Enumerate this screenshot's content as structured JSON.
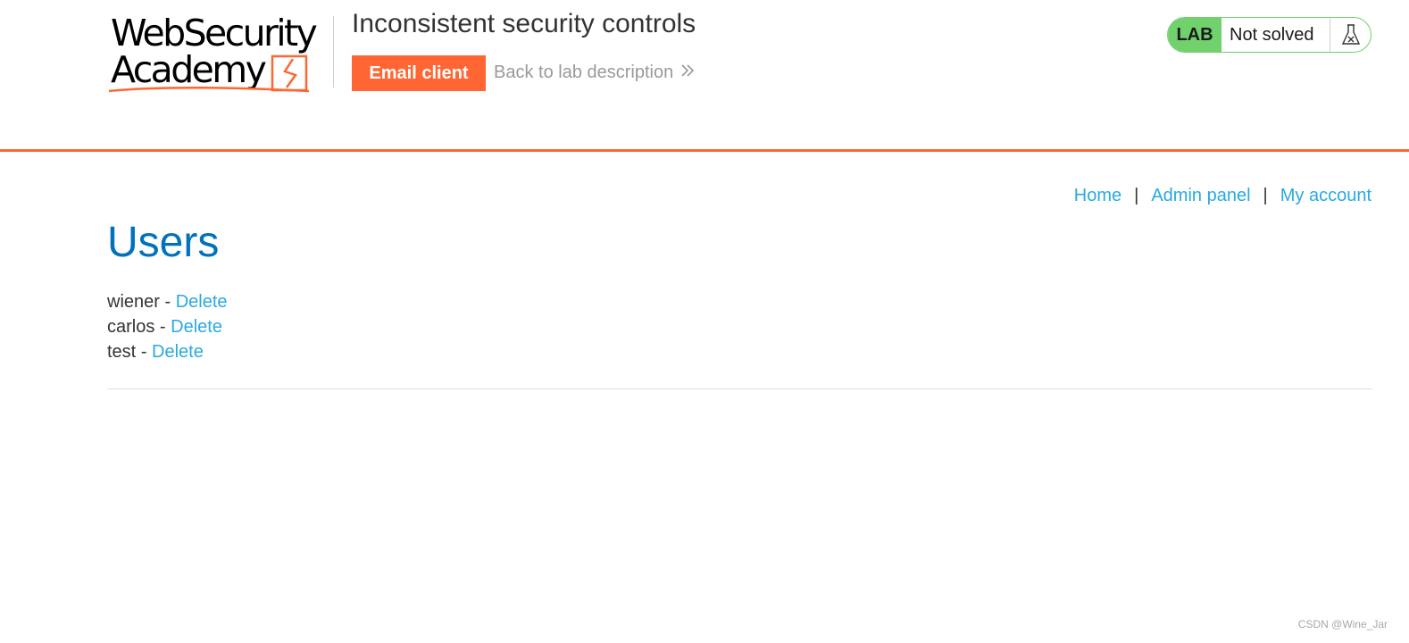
{
  "header": {
    "logo": {
      "line1": "WebSecurity",
      "line2": "Academy"
    },
    "lab_title": "Inconsistent security controls",
    "email_client_label": "Email client",
    "back_link_label": "Back to lab description",
    "lab_status": {
      "badge": "LAB",
      "status": "Not solved",
      "icon": "flask-icon"
    },
    "accent_color": "#ff6633",
    "status_color": "#70d16d"
  },
  "nav": {
    "links": [
      {
        "label": "Home"
      },
      {
        "label": "Admin panel"
      },
      {
        "label": "My account"
      }
    ],
    "separator": "|"
  },
  "main": {
    "title": "Users",
    "users": [
      {
        "name": "wiener",
        "separator": "-",
        "action": "Delete"
      },
      {
        "name": "carlos",
        "separator": "-",
        "action": "Delete"
      },
      {
        "name": "test",
        "separator": "-",
        "action": "Delete"
      }
    ]
  },
  "watermark": "CSDN @Wine_Jar"
}
